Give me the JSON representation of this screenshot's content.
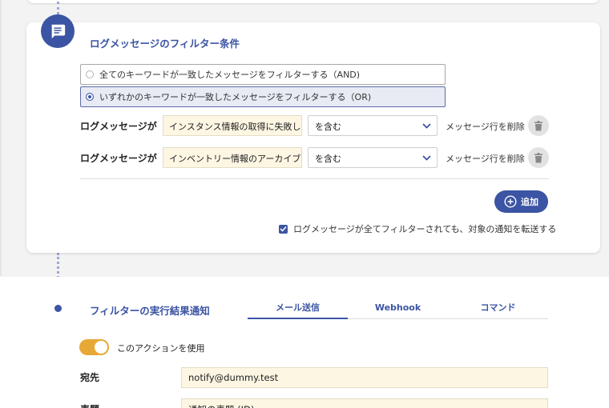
{
  "filter_section": {
    "title": "ログメッセージのフィルター条件",
    "radio_options": [
      {
        "label": "全てのキーワードが一致したメッセージをフィルターする（AND)",
        "selected": false
      },
      {
        "label": "いずれかのキーワードが一致したメッセージをフィルターする（OR)",
        "selected": true
      }
    ],
    "conditions": [
      {
        "label": "ログメッセージが",
        "keyword": "インスタンス情報の取得に失敗し",
        "operator": "を含む",
        "delete_label": "メッセージ行を削除"
      },
      {
        "label": "ログメッセージが",
        "keyword": "インベントリー情報のアーカイブ",
        "operator": "を含む",
        "delete_label": "メッセージ行を削除"
      }
    ],
    "add_button_label": "追加",
    "forward_checkbox": {
      "label": "ログメッセージが全てフィルターされても、対象の通知を転送する",
      "checked": true
    }
  },
  "notification_section": {
    "title": "フィルターの実行結果通知",
    "tabs": [
      {
        "label": "メール送信",
        "active": true
      },
      {
        "label": "Webhook",
        "active": false
      },
      {
        "label": "コマンド",
        "active": false
      }
    ],
    "use_action": {
      "label": "このアクションを使用",
      "on": true
    },
    "fields": [
      {
        "label": "宛先",
        "value": "notify@dummy.test"
      },
      {
        "label": "表題",
        "value": "通知の表題 (ID)"
      }
    ]
  },
  "colors": {
    "accent": "#3b54a3",
    "toggle": "#e7a836",
    "input_bg": "#fdf6e3"
  },
  "icons": {
    "bubble": "message-icon",
    "trash": "trash-icon",
    "add": "plus-circle-icon",
    "select": "chevron-down-icon"
  }
}
